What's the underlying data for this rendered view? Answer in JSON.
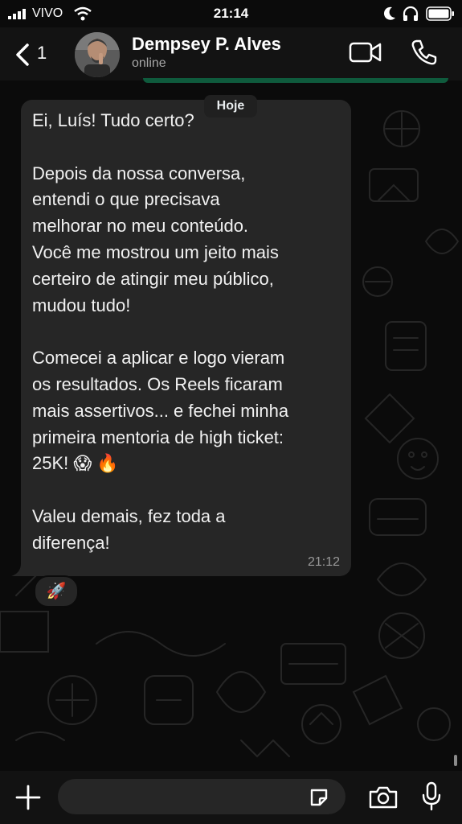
{
  "status_bar": {
    "carrier": "VIVO",
    "time": "21:14"
  },
  "header": {
    "back_count": "1",
    "contact_name": "Dempsey P. Alves",
    "contact_status": "online"
  },
  "chat": {
    "date_label": "Hoje",
    "message": {
      "text": "Ei, Luís! Tudo certo?\n\nDepois da nossa conversa,\nentendi o que precisava\nmelhorar no meu conteúdo.\nVocê me mostrou um jeito mais\ncerteiro de atingir meu público,\nmudou tudo!\n\nComecei a aplicar e logo vieram\nos resultados. Os Reels ficaram\nmais assertivos... e fechei minha\nprimeira mentoria de high ticket:\n25K! 😱 🔥\n\nValeu demais, fez toda a\ndiferença!",
      "time": "21:12",
      "reaction": "🚀"
    }
  },
  "input_bar": {
    "placeholder": ""
  },
  "colors": {
    "accent_green": "#0f5b3d",
    "bubble": "#262626",
    "background": "#0b0b0b"
  }
}
